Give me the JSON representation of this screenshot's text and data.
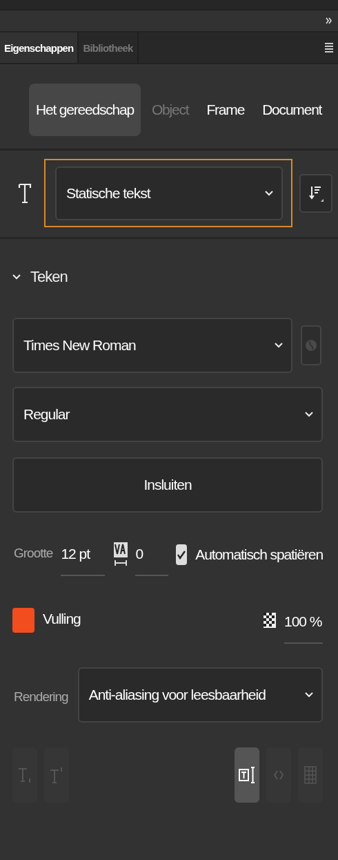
{
  "panel_tabs": [
    {
      "label": "Eigenschappen",
      "selected": true
    },
    {
      "label": "Bibliotheek",
      "selected": false
    }
  ],
  "mode_tabs": [
    {
      "label": "Het gereedschap",
      "selected": true,
      "disabled": false
    },
    {
      "label": "Object",
      "selected": false,
      "disabled": true
    },
    {
      "label": "Frame",
      "selected": false,
      "disabled": false
    },
    {
      "label": "Document",
      "selected": false,
      "disabled": false
    }
  ],
  "text_type": {
    "value": "Statische tekst"
  },
  "section": {
    "title": "Teken",
    "expanded": true
  },
  "font_family": {
    "value": "Times New Roman"
  },
  "font_style": {
    "value": "Regular"
  },
  "embed_button": "Insluiten",
  "size": {
    "label": "Grootte",
    "value": "12 pt"
  },
  "tracking": {
    "value": "0"
  },
  "auto_kerning": {
    "label": "Automatisch spatiëren",
    "checked": true
  },
  "fill": {
    "label": "Vulling",
    "color": "#f24d1f",
    "opacity": "100 %"
  },
  "rendering": {
    "label": "Rendering",
    "value": "Anti-aliasing voor leesbaarheid"
  },
  "bottom_buttons": [
    {
      "kind": "subscript",
      "disabled": true,
      "selected": false
    },
    {
      "kind": "superscript",
      "disabled": true,
      "selected": false
    },
    {
      "kind": "selectable",
      "disabled": false,
      "selected": true
    },
    {
      "kind": "html",
      "disabled": true,
      "selected": false
    },
    {
      "kind": "border",
      "disabled": true,
      "selected": false
    }
  ]
}
